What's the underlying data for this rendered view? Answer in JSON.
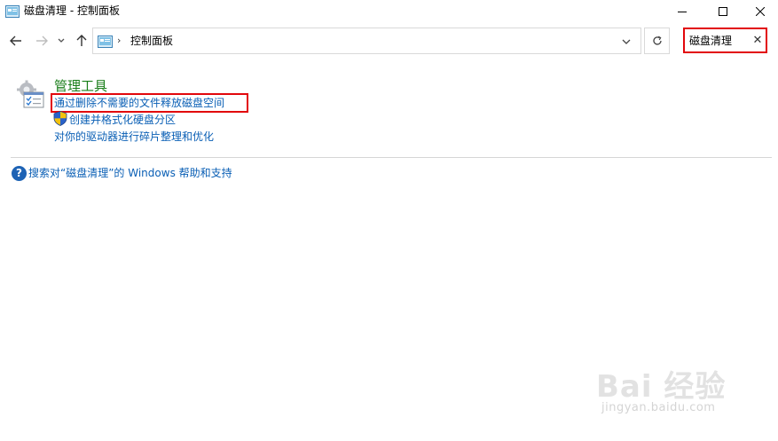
{
  "window": {
    "title": "磁盘清理 - 控制面板",
    "controls": {
      "minimize": "minimize-icon",
      "maximize": "maximize-icon",
      "close": "close-icon"
    }
  },
  "navigation": {
    "back": "back-arrow-icon",
    "forward": "forward-arrow-icon",
    "recent": "chevron-down-icon",
    "up": "up-arrow-icon"
  },
  "address": {
    "separator": "›",
    "location": "控制面板"
  },
  "search": {
    "value": "磁盘清理",
    "clear_label": "✕"
  },
  "results": {
    "group_title": "管理工具",
    "tasks": [
      {
        "label": "通过删除不需要的文件释放磁盘空间",
        "highlighted": true
      },
      {
        "label": "创建并格式化硬盘分区",
        "icon": "uac-shield-icon"
      },
      {
        "label": "对你的驱动器进行碎片整理和优化"
      }
    ]
  },
  "help": {
    "icon_text": "?",
    "link": "搜索对“磁盘清理”的 Windows 帮助和支持"
  },
  "watermark": {
    "logo": "Bai 经验",
    "url": "jingyan.baidu.com"
  },
  "colors": {
    "link": "#0a5fb5",
    "group_title": "#1a7e1a",
    "highlight_border": "#e2070c",
    "help_icon": "#1e63b5"
  }
}
